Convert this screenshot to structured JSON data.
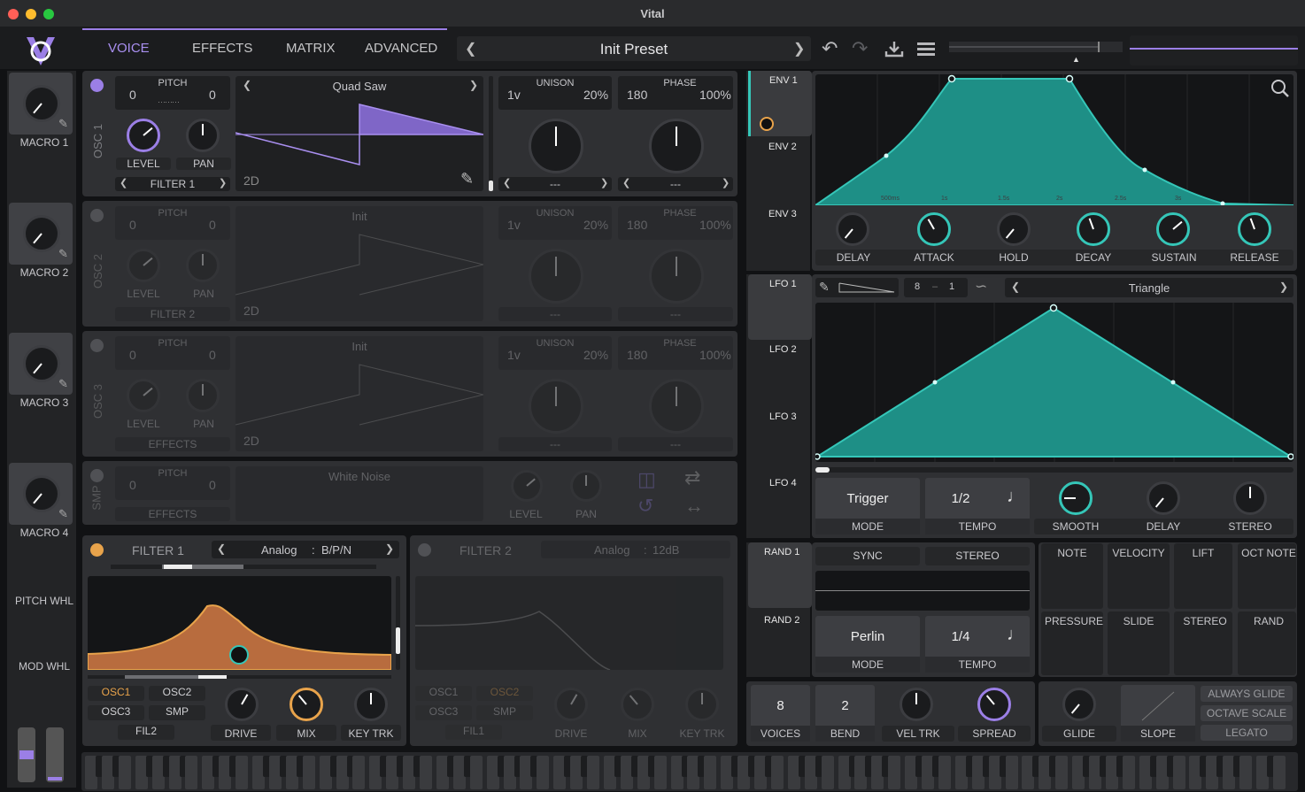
{
  "window": {
    "title": "Vital"
  },
  "nav": {
    "tabs": [
      "VOICE",
      "EFFECTS",
      "MATRIX",
      "ADVANCED"
    ],
    "active": "VOICE"
  },
  "preset": {
    "name": "Init Preset"
  },
  "macros": [
    {
      "label": "MACRO 1"
    },
    {
      "label": "MACRO 2"
    },
    {
      "label": "MACRO 3"
    },
    {
      "label": "MACRO 4"
    }
  ],
  "wheels": {
    "pitch": "PITCH WHL",
    "mod": "MOD WHL"
  },
  "osc1": {
    "side": "OSC 1",
    "pitch_label": "PITCH",
    "pitch_left": "0",
    "pitch_right": "0",
    "wave": "Quad Saw",
    "dim": "2D",
    "level": "LEVEL",
    "pan": "PAN",
    "dest": "FILTER 1",
    "unison_label": "UNISON",
    "unison_voices": "1v",
    "unison_detune": "20%",
    "phase_label": "PHASE",
    "phase_val": "180",
    "phase_pct": "100%",
    "spec1": "---",
    "spec2": "---"
  },
  "osc2": {
    "side": "OSC 2",
    "pitch_label": "PITCH",
    "pitch_left": "0",
    "pitch_right": "0",
    "wave": "Init",
    "dim": "2D",
    "level": "LEVEL",
    "pan": "PAN",
    "dest": "FILTER 2",
    "unison_label": "UNISON",
    "unison_voices": "1v",
    "unison_detune": "20%",
    "phase_label": "PHASE",
    "phase_val": "180",
    "phase_pct": "100%",
    "spec1": "---",
    "spec2": "---"
  },
  "osc3": {
    "side": "OSC 3",
    "pitch_label": "PITCH",
    "pitch_left": "0",
    "pitch_right": "0",
    "wave": "Init",
    "dim": "2D",
    "level": "LEVEL",
    "pan": "PAN",
    "dest": "EFFECTS",
    "unison_label": "UNISON",
    "unison_voices": "1v",
    "unison_detune": "20%",
    "phase_label": "PHASE",
    "phase_val": "180",
    "phase_pct": "100%",
    "spec1": "---",
    "spec2": "---"
  },
  "smp": {
    "side": "SMP",
    "pitch_label": "PITCH",
    "pitch_left": "0",
    "pitch_right": "0",
    "sample": "White Noise",
    "dest": "EFFECTS",
    "level": "LEVEL",
    "pan": "PAN"
  },
  "filter1": {
    "name": "FILTER 1",
    "type": "Analog",
    "mode": "B/P/N",
    "routes": [
      "OSC1",
      "OSC2",
      "OSC3",
      "SMP",
      "FIL2"
    ],
    "knobs": [
      "DRIVE",
      "MIX",
      "KEY TRK"
    ]
  },
  "filter2": {
    "name": "FILTER 2",
    "type": "Analog",
    "mode": "12dB",
    "routes": [
      "OSC1",
      "OSC2",
      "OSC3",
      "SMP",
      "FIL1"
    ],
    "knobs": [
      "DRIVE",
      "MIX",
      "KEY TRK"
    ]
  },
  "env": {
    "tabs": [
      "ENV 1",
      "ENV 2",
      "ENV 3"
    ],
    "knobs": [
      "DELAY",
      "ATTACK",
      "HOLD",
      "DECAY",
      "SUSTAIN",
      "RELEASE"
    ],
    "time_labels": [
      "500ms",
      "1s",
      "1.5s",
      "2s",
      "2.5s",
      "3s"
    ]
  },
  "lfo": {
    "tabs": [
      "LFO 1",
      "LFO 2",
      "LFO 3",
      "LFO 4"
    ],
    "grid_x": "8",
    "grid_sep": "–",
    "grid_y": "1",
    "shape": "Triangle",
    "mode_val": "Trigger",
    "mode_label": "MODE",
    "tempo_val": "1/2",
    "tempo_label": "TEMPO",
    "knobs": [
      "SMOOTH",
      "DELAY",
      "STEREO"
    ]
  },
  "rand": {
    "tabs": [
      "RAND 1",
      "RAND 2"
    ],
    "sync": "SYNC",
    "stereo": "STEREO",
    "mode_val": "Perlin",
    "mode_label": "MODE",
    "tempo_val": "1/4",
    "tempo_label": "TEMPO"
  },
  "mod_sources": [
    "NOTE",
    "VELOCITY",
    "LIFT",
    "OCT NOTE",
    "PRESSURE",
    "SLIDE",
    "STEREO",
    "RAND"
  ],
  "voice": {
    "voices_val": "8",
    "voices_label": "VOICES",
    "bend_val": "2",
    "bend_label": "BEND",
    "vel_trk": "VEL TRK",
    "spread": "SPREAD",
    "glide": "GLIDE",
    "slope": "SLOPE",
    "toggles": [
      "ALWAYS GLIDE",
      "OCTAVE SCALE",
      "LEGATO"
    ]
  },
  "colors": {
    "accent": "#9b7fe6",
    "teal": "#35c6b8",
    "orange": "#e8a34b",
    "panel": "#2f3033"
  }
}
